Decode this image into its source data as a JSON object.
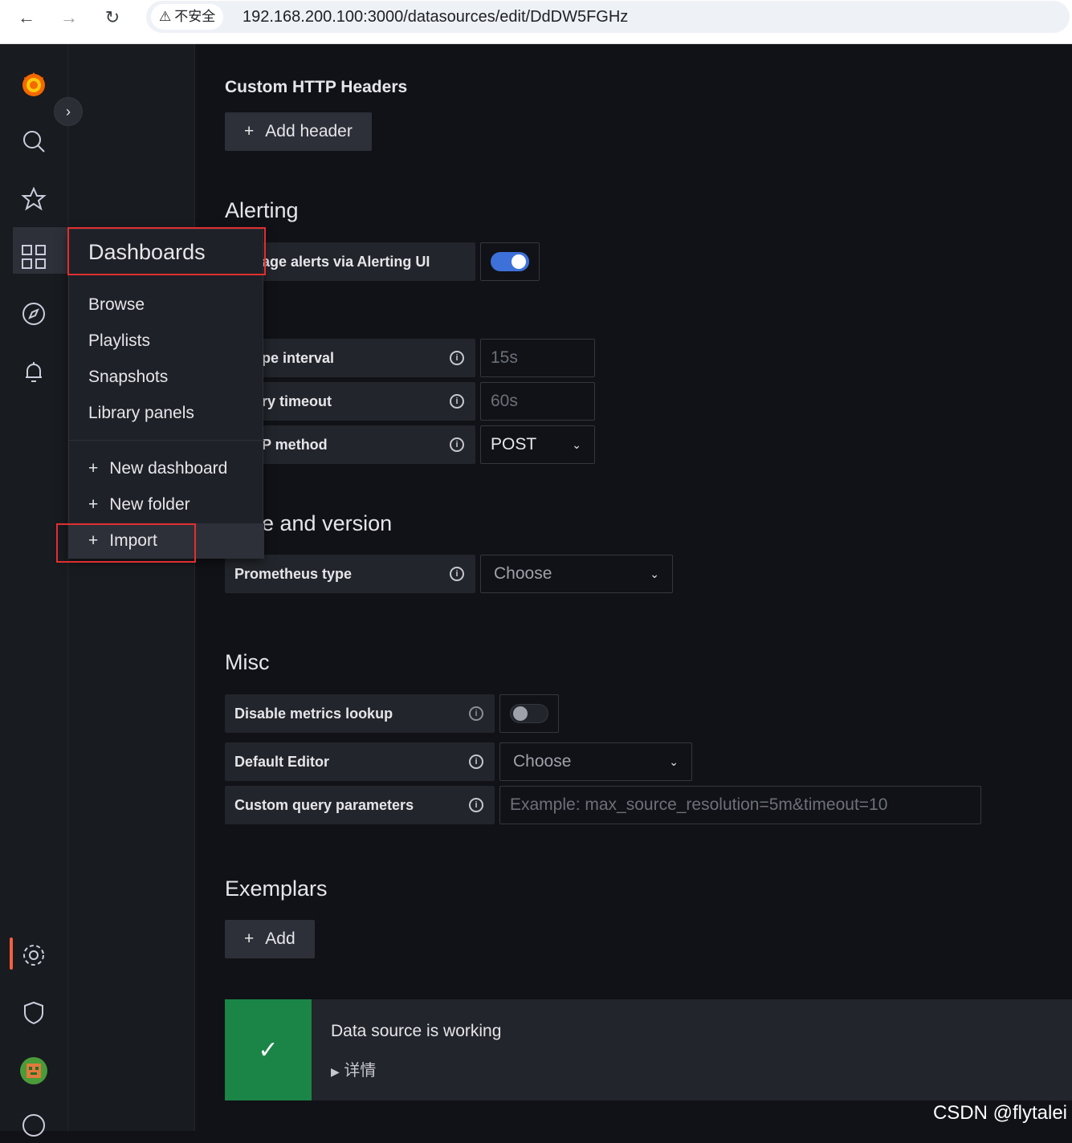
{
  "browser": {
    "security_label": "不安全",
    "url": "192.168.200.100:3000/datasources/edit/DdDW5FGHz"
  },
  "sidemenu": {
    "expand_label": "›"
  },
  "flyout": {
    "title": "Dashboards",
    "items": [
      "Browse",
      "Playlists",
      "Snapshots",
      "Library panels"
    ],
    "actions": [
      "New dashboard",
      "New folder",
      "Import"
    ]
  },
  "main": {
    "custom_headers_title": "Custom HTTP Headers",
    "add_header_label": "Add header",
    "alerting_title": "Alerting",
    "manage_alerts_label": "age alerts via Alerting UI",
    "manage_alerts_enabled": true,
    "scrape_interval_label": "pe interval",
    "scrape_interval_placeholder": "15s",
    "query_timeout_label": "ry timeout",
    "query_timeout_placeholder": "60s",
    "http_method_label": "P method",
    "http_method_value": "POST",
    "type_version_title": "e and version",
    "prometheus_type_label": "Prometheus type",
    "prometheus_type_value": "Choose",
    "misc_title": "Misc",
    "disable_metrics_label": "Disable metrics lookup",
    "disable_metrics_enabled": false,
    "default_editor_label": "Default Editor",
    "default_editor_value": "Choose",
    "custom_query_label": "Custom query parameters",
    "custom_query_placeholder": "Example: max_source_resolution=5m&timeout=10",
    "exemplars_title": "Exemplars",
    "add_label": "Add",
    "alert_title": "Data source is working",
    "alert_details": "详情"
  },
  "watermark": "CSDN @flytalei",
  "colors": {
    "background": "#111217",
    "panel": "#181b1f",
    "accent_blue": "#3d71d9",
    "success": "#1b8548",
    "highlight_red": "#e02f2f",
    "active_orange": "#f55f3e"
  }
}
